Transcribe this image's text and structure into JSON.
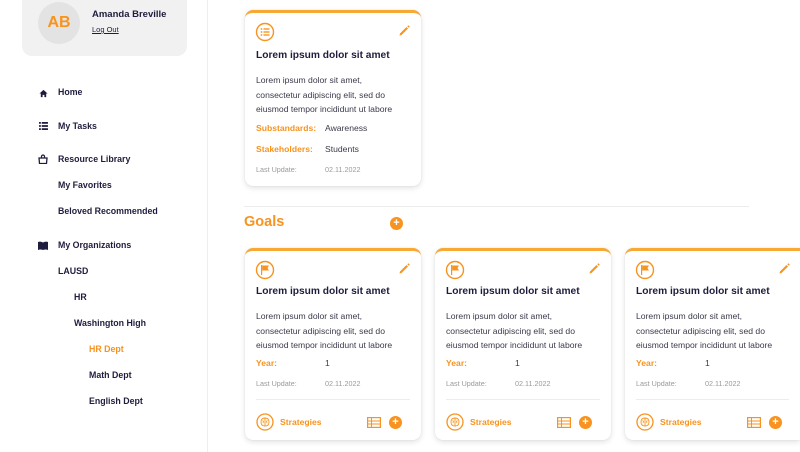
{
  "user": {
    "initials": "AB",
    "name": "Amanda Breville",
    "logout_label": "Log Out"
  },
  "nav": {
    "home": "Home",
    "my_tasks": "My Tasks",
    "resource_library": "Resource Library",
    "my_favorites": "My Favorites",
    "beloved_recommended": "Beloved Recommended",
    "my_organizations": "My Organizations",
    "lausd": "LAUSD",
    "hr": "HR",
    "washington_high": "Washington High",
    "hr_dept": "HR Dept",
    "math_dept": "Math Dept",
    "english_dept": "English Dept"
  },
  "top_card": {
    "title": "Lorem ipsum dolor sit amet",
    "desc_lines": [
      "Lorem ipsum dolor sit amet,",
      "consectetur adipiscing elit, sed do",
      "eiusmod tempor incididunt ut labore"
    ],
    "substandards_label": "Substandards:",
    "substandards_value": "Awareness",
    "stakeholders_label": "Stakeholders:",
    "stakeholders_value": "Students",
    "last_update_label": "Last Update:",
    "last_update_value": "02.11.2022"
  },
  "goals": {
    "title": "Goals",
    "add_label": "+",
    "cards": [
      {
        "title": "Lorem ipsum dolor sit amet",
        "desc_lines": [
          "Lorem ipsum dolor sit amet,",
          "consectetur adipiscing elit, sed do",
          "eiusmod tempor incididunt ut labore"
        ],
        "year_label": "Year:",
        "year_value": "1",
        "last_update_label": "Last Update:",
        "last_update_value": "02.11.2022",
        "strategies_label": "Strategies",
        "add_label": "+"
      },
      {
        "title": "Lorem ipsum dolor sit amet",
        "desc_lines": [
          "Lorem ipsum dolor sit amet,",
          "consectetur adipiscing elit, sed do",
          "eiusmod tempor incididunt ut labore"
        ],
        "year_label": "Year:",
        "year_value": "1",
        "last_update_label": "Last Update:",
        "last_update_value": "02.11.2022",
        "strategies_label": "Strategies",
        "add_label": "+"
      },
      {
        "title": "Lorem ipsum dolor sit amet",
        "desc_lines": [
          "Lorem ipsum dolor sit amet,",
          "consectetur adipiscing elit, sed do",
          "eiusmod tempor incididunt ut labore"
        ],
        "year_label": "Year:",
        "year_value": "1",
        "last_update_label": "Last Update:",
        "last_update_value": "02.11.2022",
        "strategies_label": "Strategies",
        "add_label": "+"
      }
    ]
  },
  "colors": {
    "accent": "#f7931e",
    "text": "#1f1d3d",
    "card_border": "#f7a934"
  },
  "icons": {
    "home": "home-icon",
    "tasks": "list-icon",
    "library": "library-icon",
    "organizations": "book-icon",
    "edit": "pencil-icon",
    "standard": "list-circle-icon",
    "goal": "flag-icon",
    "strategies": "brain-icon",
    "table": "table-icon",
    "add": "plus-icon"
  }
}
